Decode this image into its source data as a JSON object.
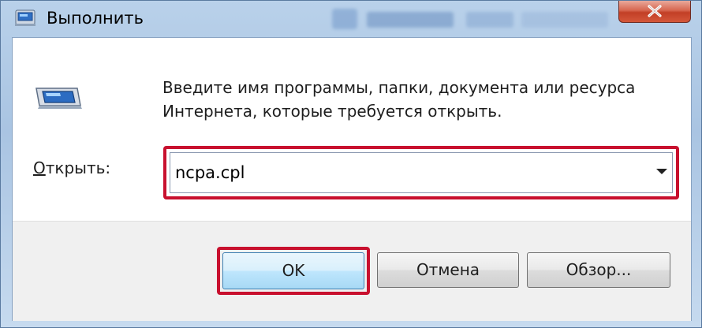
{
  "window": {
    "title": "Выполнить",
    "close_label": "×"
  },
  "dialog": {
    "description": "Введите имя программы, папки, документа или ресурса Интернета, которые требуется открыть.",
    "open_label_accel": "О",
    "open_label_rest": "ткрыть:",
    "input_value": "ncpa.cpl"
  },
  "buttons": {
    "ok": "OK",
    "cancel": "Отмена",
    "browse": "Обзор..."
  },
  "colors": {
    "highlight": "#c8102e",
    "close_button": "#c23f26"
  },
  "icons": {
    "window": "run-dialog-icon",
    "close": "close-icon",
    "dropdown": "chevron-down-icon"
  }
}
